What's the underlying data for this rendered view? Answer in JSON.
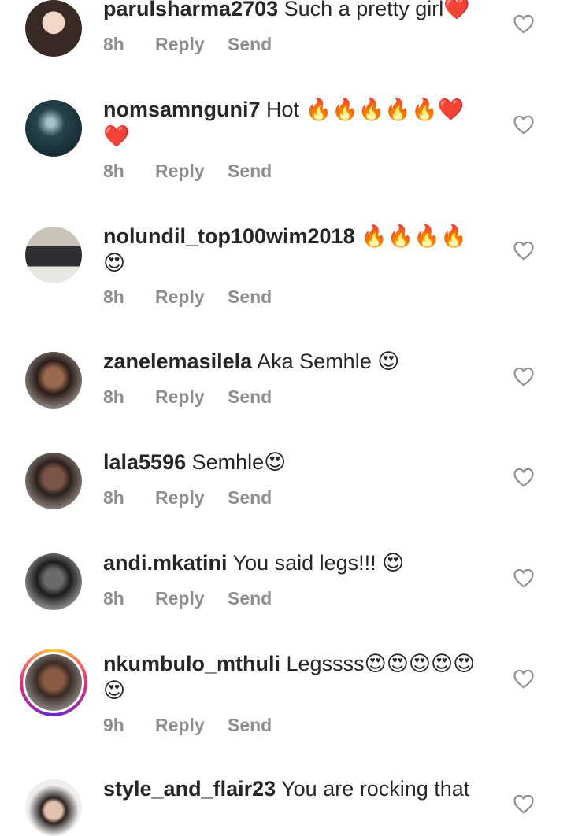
{
  "comments": [
    {
      "username": "parulsharma2703",
      "text": "Such a pretty girl❤️",
      "time": "8h",
      "reply": "Reply",
      "send": "Send"
    },
    {
      "username": "nomsamnguni7",
      "text": "Hot 🔥🔥🔥🔥🔥❤️❤️",
      "time": "8h",
      "reply": "Reply",
      "send": "Send"
    },
    {
      "username": "nolundil_top100wim2018",
      "text": "🔥🔥🔥🔥😍",
      "time": "8h",
      "reply": "Reply",
      "send": "Send"
    },
    {
      "username": "zanelemasilela",
      "text": "Aka Semhle 😍",
      "time": "8h",
      "reply": "Reply",
      "send": "Send"
    },
    {
      "username": "lala5596",
      "text": "Semhle😍",
      "time": "8h",
      "reply": "Reply",
      "send": "Send"
    },
    {
      "username": "andi.mkatini",
      "text": "You said legs!!! 😍",
      "time": "8h",
      "reply": "Reply",
      "send": "Send"
    },
    {
      "username": "nkumbulo_mthuli",
      "text": "Legssss😍😍😍😍😍😍",
      "time": "9h",
      "reply": "Reply",
      "send": "Send"
    },
    {
      "username": "style_and_flair23",
      "text": "You are rocking that",
      "time": "",
      "reply": "",
      "send": ""
    }
  ],
  "colors": {
    "text": "#262626",
    "meta": "#8e8e8e",
    "heart_outline": "#8e8e8e"
  },
  "icons": {
    "like": "heart-outline-icon"
  }
}
